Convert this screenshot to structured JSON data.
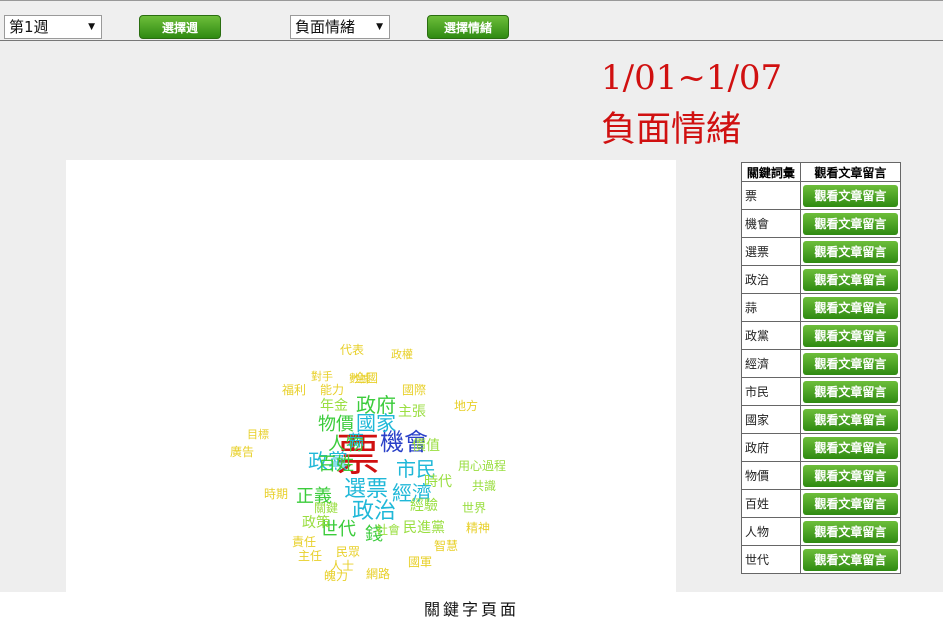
{
  "toolbar": {
    "week_select": "第1週",
    "week_button": "選擇週",
    "emotion_select": "負面情緒",
    "emotion_button": "選擇情緒"
  },
  "heading": {
    "date_range": "1/01~1/07",
    "emotion": "負面情緒"
  },
  "table": {
    "col_keyword": "關鍵詞彙",
    "col_view": "觀看文章留言",
    "rows": [
      {
        "keyword": "票",
        "button": "觀看文章留言"
      },
      {
        "keyword": "機會",
        "button": "觀看文章留言"
      },
      {
        "keyword": "選票",
        "button": "觀看文章留言"
      },
      {
        "keyword": "政治",
        "button": "觀看文章留言"
      },
      {
        "keyword": "蒜",
        "button": "觀看文章留言"
      },
      {
        "keyword": "政黨",
        "button": "觀看文章留言"
      },
      {
        "keyword": "經濟",
        "button": "觀看文章留言"
      },
      {
        "keyword": "市民",
        "button": "觀看文章留言"
      },
      {
        "keyword": "國家",
        "button": "觀看文章留言"
      },
      {
        "keyword": "政府",
        "button": "觀看文章留言"
      },
      {
        "keyword": "物價",
        "button": "觀看文章留言"
      },
      {
        "keyword": "百姓",
        "button": "觀看文章留言"
      },
      {
        "keyword": "人物",
        "button": "觀看文章留言"
      },
      {
        "keyword": "世代",
        "button": "觀看文章留言"
      }
    ]
  },
  "colors": {
    "red": "#d01010",
    "blue": "#2a40c8",
    "cyan": "#20b8d8",
    "green": "#3ccc3c",
    "lightgreen": "#9ade40",
    "yellow": "#e8d02a"
  },
  "cloud_words": [
    {
      "t": "票",
      "c": "#d01010"
    },
    {
      "t": "機會",
      "c": "#2a40c8"
    },
    {
      "t": "選票",
      "c": "#20b8d8"
    },
    {
      "t": "政治",
      "c": "#20b8d8"
    },
    {
      "t": "政黨",
      "c": "#20b8d8"
    },
    {
      "t": "市民",
      "c": "#20b8d8"
    },
    {
      "t": "經濟",
      "c": "#20b8d8"
    },
    {
      "t": "國家",
      "c": "#20b8d8"
    },
    {
      "t": "政府",
      "c": "#3ccc3c"
    },
    {
      "t": "物價",
      "c": "#3ccc3c"
    },
    {
      "t": "百姓",
      "c": "#3ccc3c"
    },
    {
      "t": "人物",
      "c": "#3ccc3c"
    },
    {
      "t": "世代",
      "c": "#3ccc3c"
    },
    {
      "t": "錢",
      "c": "#3ccc3c"
    },
    {
      "t": "正義",
      "c": "#3ccc3c"
    },
    {
      "t": "蒜",
      "c": "#20b8d8"
    },
    {
      "t": "主張",
      "c": "#9ade40"
    },
    {
      "t": "價值",
      "c": "#9ade40"
    },
    {
      "t": "時代",
      "c": "#9ade40"
    },
    {
      "t": "經驗",
      "c": "#9ade40"
    },
    {
      "t": "年金",
      "c": "#9ade40"
    },
    {
      "t": "關鍵",
      "c": "#9ade40"
    },
    {
      "t": "民進黨",
      "c": "#9ade40"
    },
    {
      "t": "用心",
      "c": "#9ade40"
    },
    {
      "t": "過程",
      "c": "#9ade40"
    },
    {
      "t": "共識",
      "c": "#9ade40"
    },
    {
      "t": "世界",
      "c": "#9ade40"
    },
    {
      "t": "精神",
      "c": "#e8d02a"
    },
    {
      "t": "國際",
      "c": "#e8d02a"
    },
    {
      "t": "全國",
      "c": "#e8d02a"
    },
    {
      "t": "福利",
      "c": "#e8d02a"
    },
    {
      "t": "能力",
      "c": "#e8d02a"
    },
    {
      "t": "代表",
      "c": "#e8d02a"
    },
    {
      "t": "社會",
      "c": "#9ade40"
    },
    {
      "t": "地方",
      "c": "#e8d02a"
    },
    {
      "t": "目標",
      "c": "#e8d02a"
    },
    {
      "t": "廣告",
      "c": "#e8d02a"
    },
    {
      "t": "時期",
      "c": "#e8d02a"
    },
    {
      "t": "政策",
      "c": "#9ade40"
    },
    {
      "t": "責任",
      "c": "#e8d02a"
    },
    {
      "t": "主任",
      "c": "#e8d02a"
    },
    {
      "t": "民眾",
      "c": "#e8d02a"
    },
    {
      "t": "人士",
      "c": "#e8d02a"
    },
    {
      "t": "國軍",
      "c": "#e8d02a"
    },
    {
      "t": "魄力",
      "c": "#e8d02a"
    },
    {
      "t": "網路",
      "c": "#e8d02a"
    },
    {
      "t": "智慧",
      "c": "#e8d02a"
    },
    {
      "t": "數據",
      "c": "#e8d02a"
    },
    {
      "t": "政權",
      "c": "#e8d02a"
    },
    {
      "t": "對手",
      "c": "#e8d02a"
    }
  ],
  "caption": "關鍵字頁面"
}
